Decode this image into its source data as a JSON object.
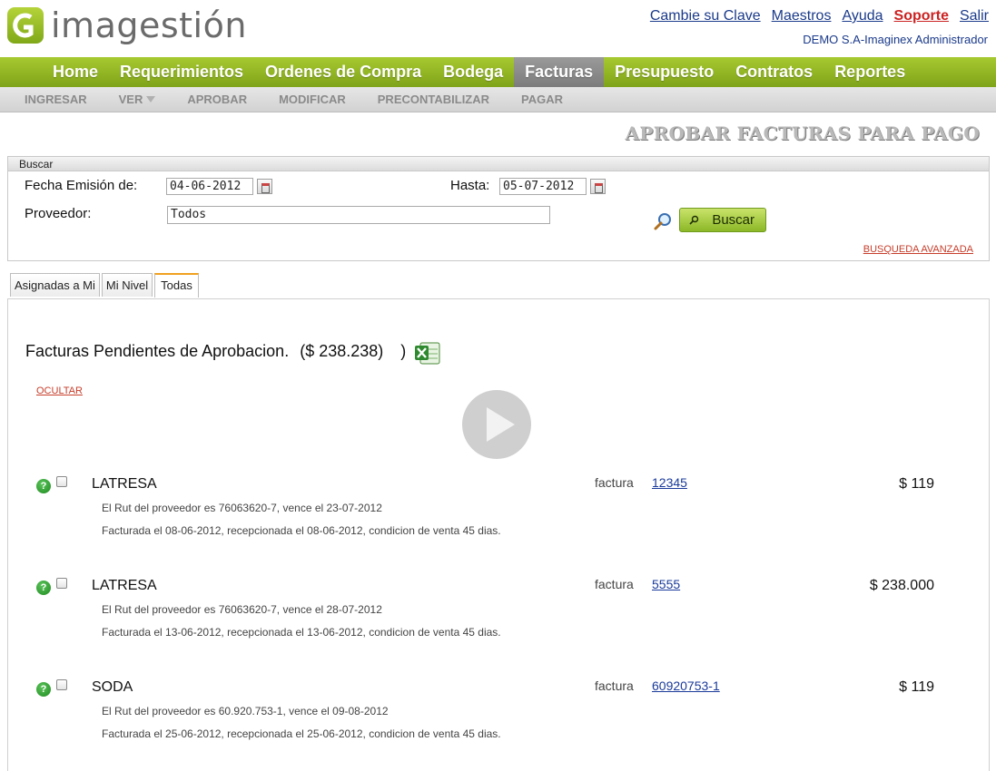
{
  "app": {
    "logo_text": "imagestión",
    "top_links": [
      "Cambie su Clave",
      "Maestros",
      "Ayuda",
      "Soporte",
      "Salir"
    ],
    "user": "DEMO S.A-Imaginex Administrador"
  },
  "main_nav": [
    "Home",
    "Requerimientos",
    "Ordenes de Compra",
    "Bodega",
    "Facturas",
    "Presupuesto",
    "Contratos",
    "Reportes"
  ],
  "sub_nav": [
    "INGRESAR",
    "VER",
    "APROBAR",
    "MODIFICAR",
    "PRECONTABILIZAR",
    "PAGAR"
  ],
  "page_title": "APROBAR FACTURAS PARA PAGO",
  "search": {
    "header": "Buscar",
    "fecha_label": "Fecha Emisión de:",
    "fecha_from": "04-06-2012",
    "hasta_label": "Hasta:",
    "fecha_to": "05-07-2012",
    "proveedor_label": "Proveedor:",
    "proveedor_value": "Todos",
    "button": "Buscar",
    "advanced": "BUSQUEDA AVANZADA"
  },
  "tabs": [
    "Asignadas a Mi",
    "Mi Nivel",
    "Todas"
  ],
  "summary": {
    "title": "Facturas Pendientes de Aprobacion.",
    "amount": "($ 238.238)",
    "close_paren": ")",
    "hide": "OCULTAR"
  },
  "invoices": [
    {
      "name": "LATRESA",
      "kind": "factura",
      "number": "12345",
      "amount": "$ 119",
      "line1": "El Rut del proveedor es 76063620-7, vence el 23-07-2012",
      "line2": "Facturada el 08-06-2012, recepcionada el 08-06-2012, condicion de venta 45 dias."
    },
    {
      "name": "LATRESA",
      "kind": "factura",
      "number": "5555",
      "amount": "$ 238.000",
      "line1": "El Rut del proveedor es 76063620-7, vence el 28-07-2012",
      "line2": "Facturada el 13-06-2012, recepcionada el 13-06-2012, condicion de venta 45 dias."
    },
    {
      "name": "SODA",
      "kind": "factura",
      "number": "60920753-1",
      "amount": "$ 119",
      "line1": "El Rut del proveedor es 60.920.753-1, vence el 09-08-2012",
      "line2": "Facturada el 25-06-2012, recepcionada el 25-06-2012, condicion de venta 45 dias."
    }
  ],
  "colors": {
    "nav_green": "#8fb424",
    "link_blue": "#1a3a8a",
    "support_red": "#cc2222",
    "accent_red": "#c63d2a"
  }
}
